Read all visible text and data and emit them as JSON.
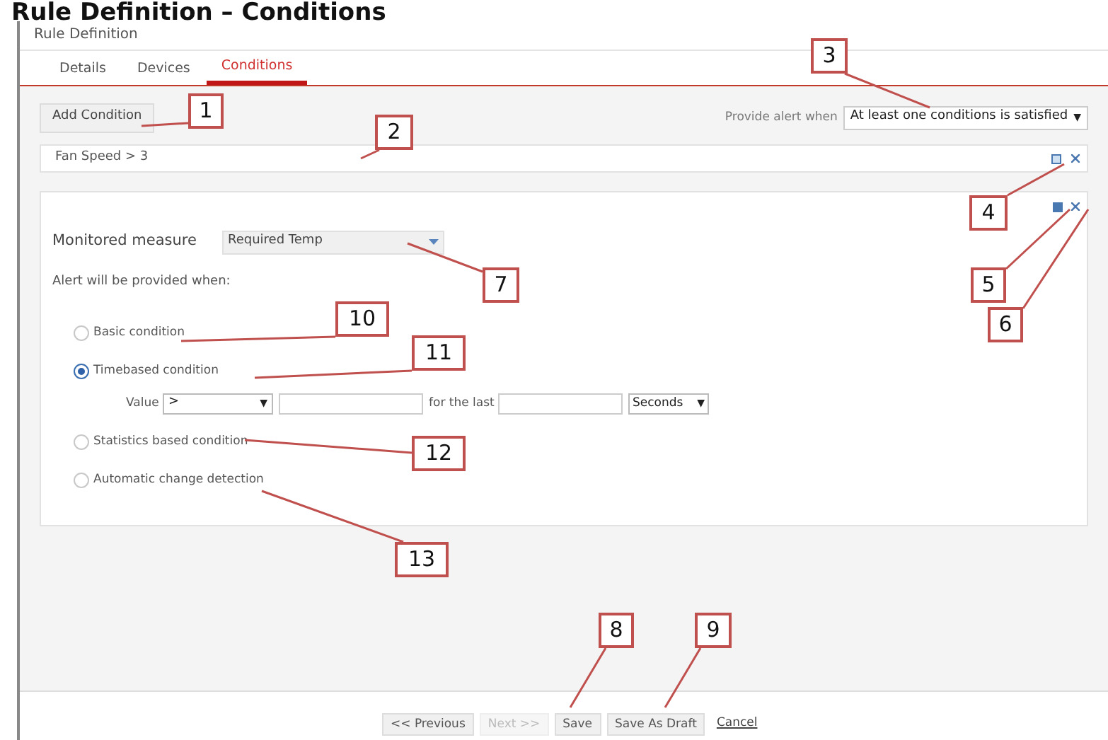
{
  "heading": "Rule Definition – Conditions",
  "window": {
    "title": "Rule Definition"
  },
  "tabs": [
    {
      "label": "Details",
      "selected": false
    },
    {
      "label": "Devices",
      "selected": false
    },
    {
      "label": "Conditions",
      "selected": true
    }
  ],
  "add_condition_button": "Add Condition",
  "alert_rule": {
    "label": "Provide alert when",
    "value": "At least one conditions is satisfied",
    "arrow": "▼"
  },
  "conditions": [
    {
      "text": "Fan Speed > 3"
    }
  ],
  "editor": {
    "measure_label": "Monitored measure",
    "measure_value": "Required Temp",
    "alert_label": "Alert will be provided when:",
    "options": [
      {
        "label": "Basic condition",
        "selected": false,
        "kind": "plain"
      },
      {
        "label": "Timebased condition",
        "selected": true,
        "kind": "timebased"
      },
      {
        "label": "Statistics based condition",
        "selected": false,
        "kind": "plain"
      },
      {
        "label": "Automatic change detection",
        "selected": false,
        "kind": "plain"
      }
    ],
    "value_row": {
      "label": "Value",
      "operator": ">",
      "operator_arrow": "▼",
      "for_label": "for the last",
      "unit": "Seconds",
      "unit_arrow": "▼"
    }
  },
  "footer": [
    {
      "label": "<< Previous",
      "kind": "button",
      "disabled": false
    },
    {
      "label": "Next >>",
      "kind": "button",
      "disabled": true
    },
    {
      "label": "Save",
      "kind": "button",
      "disabled": false
    },
    {
      "label": "Save As Draft",
      "kind": "button",
      "disabled": false
    },
    {
      "label": "Cancel",
      "kind": "link"
    }
  ],
  "callouts": [
    {
      "label": "1"
    },
    {
      "label": "2"
    },
    {
      "label": "3"
    },
    {
      "label": "4"
    },
    {
      "label": "5"
    },
    {
      "label": "6"
    },
    {
      "label": "7"
    },
    {
      "label": "8"
    },
    {
      "label": "9"
    },
    {
      "label": "10"
    },
    {
      "label": "11"
    },
    {
      "label": "12"
    },
    {
      "label": "13"
    }
  ]
}
